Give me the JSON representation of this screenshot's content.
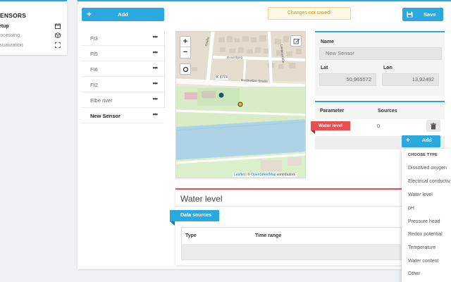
{
  "sidebar": {
    "title": "ENSORS",
    "items": [
      {
        "label": "etup",
        "icon": "calendar-icon",
        "active": true
      },
      {
        "label": "rocessing",
        "icon": "cube-icon",
        "active": false
      },
      {
        "label": "isualization",
        "icon": "expand-icon",
        "active": false
      }
    ]
  },
  "toolbar": {
    "add_label": "Add",
    "unsaved_message": "Changes not saved!",
    "save_label": "Save"
  },
  "sensors": [
    {
      "name": "FI3",
      "active": false
    },
    {
      "name": "FI5",
      "active": false
    },
    {
      "name": "FI6",
      "active": false
    },
    {
      "name": "FI2",
      "active": false
    },
    {
      "name": "Elbe river",
      "active": false
    },
    {
      "name": "New Sensor",
      "active": true
    }
  ],
  "map": {
    "road_label": "K 8774",
    "street_labels": [
      "Wachwitzer Straße",
      "Lindenstraße",
      "Rosenberg",
      "Straße"
    ],
    "attribution_leaflet": "Leaflet",
    "attribution_sep": " | © ",
    "attribution_osm": "OpenStreetMap",
    "attribution_tail": " contributors",
    "zoom_in": "+",
    "zoom_out": "−"
  },
  "properties": {
    "name_label": "Name",
    "name_value": "New Sensor",
    "lat_label": "Lat",
    "lat_value": "50,965572",
    "lon_label": "Lon",
    "lon_value": "13,92492"
  },
  "parameters": {
    "col_parameter": "Parameter",
    "col_sources": "Sources",
    "rows": [
      {
        "parameter": "Water level",
        "sources": "0"
      }
    ],
    "add_label": "Add"
  },
  "dropdown": {
    "header": "CHOOSE TYPE",
    "options": [
      "Dissolved oxygen",
      "Electrical conductiv",
      "Water level",
      "pH",
      "Pressure head",
      "Redox potential",
      "Temperature",
      "Water content",
      "Other"
    ]
  },
  "water_level_panel": {
    "title": "Water level",
    "data_sources_label": "Data sources",
    "col_type": "Type",
    "col_time_range": "Time range"
  },
  "colors": {
    "accent": "#29a9e0",
    "danger": "#e84f4f",
    "warning_text": "#e08a00"
  }
}
